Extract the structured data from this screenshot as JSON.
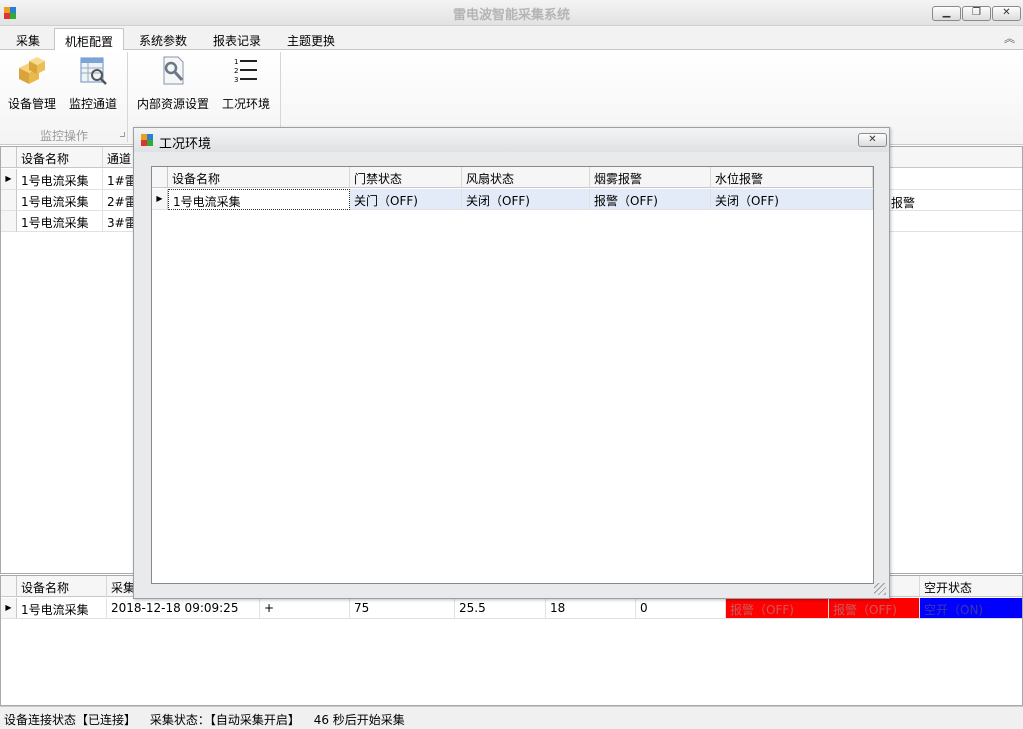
{
  "window": {
    "title": "雷电波智能采集系统",
    "min": "▁",
    "max": "❐",
    "close": "✕"
  },
  "tabs": [
    "采集",
    "机柜配置",
    "系统参数",
    "报表记录",
    "主题更换"
  ],
  "ribbon": {
    "buttons": [
      "设备管理",
      "监控通道",
      "内部资源设置",
      "工况环境"
    ],
    "group_label": "监控操作"
  },
  "top_grid": {
    "columns": [
      "设备名称",
      "通道"
    ],
    "rows": [
      [
        "1号电流采集",
        "1#雷"
      ],
      [
        "1号电流采集",
        "2#雷"
      ],
      [
        "1号电流采集",
        "3#雷"
      ]
    ],
    "right_fragment": "报警"
  },
  "dialog": {
    "title": "工况环境",
    "close": "✕",
    "columns": [
      "设备名称",
      "门禁状态",
      "风扇状态",
      "烟雾报警",
      "水位报警"
    ],
    "rows": [
      [
        "1号电流采集",
        "关门（OFF)",
        "关闭（OFF)",
        "报警（OFF)",
        "关闭（OFF)"
      ]
    ]
  },
  "bottom_grid": {
    "columns": [
      "设备名称",
      "采集",
      "空开状态"
    ],
    "row": {
      "name": "1号电流采集",
      "time": "2018-12-18 09:09:25",
      "plus": "+",
      "v1": "75",
      "v2": "25.5",
      "v3": "18",
      "v4": "0",
      "alarm1": "报警（OFF)",
      "alarm2": "报警（OFF)",
      "switch": "空开（ON)"
    },
    "colors": {
      "alarm": "#ff0000",
      "switch": "#0000ff"
    }
  },
  "status": {
    "connection": "设备连接状态【已连接】",
    "collect": "采集状态：【自动采集开启】",
    "countdown": "46 秒后开始采集"
  },
  "icons": [
    "app-icon",
    "device-manage-icon",
    "monitor-channel-icon",
    "internal-resource-icon",
    "work-environment-icon",
    "collapse-ribbon-icon",
    "row-pointer-icon",
    "resize-grip-icon"
  ]
}
